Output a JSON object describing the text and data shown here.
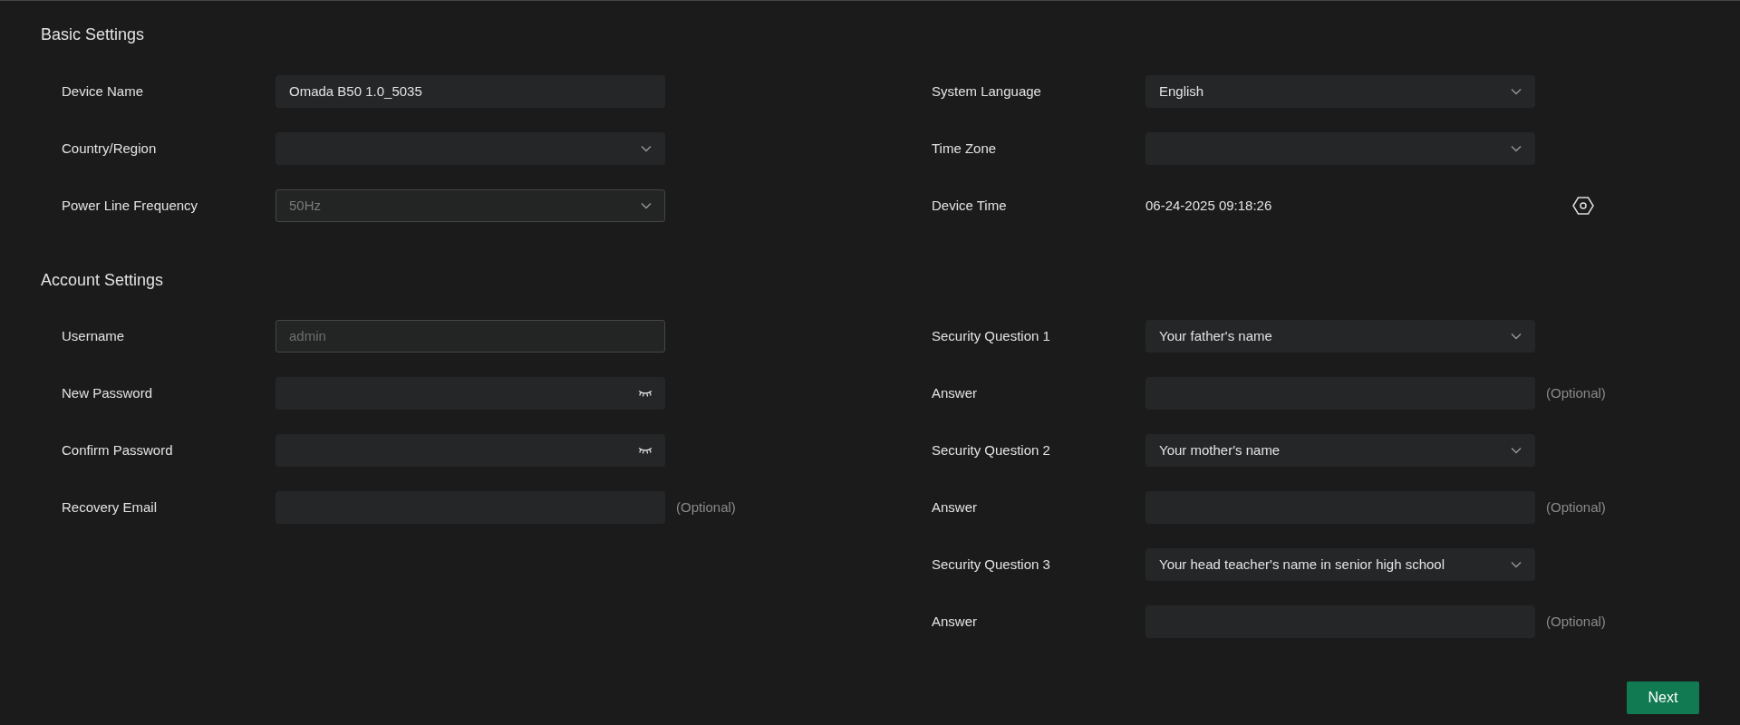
{
  "sections": [
    {
      "title": "Basic Settings",
      "left": [
        {
          "label": "Device Name",
          "kind": "text",
          "value": "Omada B50 1.0_5035",
          "disabled": false
        },
        {
          "label": "Country/Region",
          "kind": "select",
          "disabled": false
        },
        {
          "label": "Power Line Frequency",
          "kind": "select",
          "value": "50Hz",
          "disabled": true
        }
      ],
      "right": [
        {
          "label": "System Language",
          "kind": "select",
          "value": "English",
          "disabled": false
        },
        {
          "label": "Time Zone",
          "kind": "select",
          "disabled": false
        },
        {
          "label": "Device Time",
          "kind": "static",
          "value": "06-24-2025 09:18:26",
          "disabled": false
        }
      ]
    },
    {
      "title": "Account Settings",
      "left": [
        {
          "label": "Username",
          "kind": "text",
          "placeholder": "admin",
          "disabled": true
        },
        {
          "label": "New Password",
          "kind": "password",
          "disabled": false
        },
        {
          "label": "Confirm Password",
          "kind": "password",
          "disabled": false
        },
        {
          "label": "Recovery Email",
          "kind": "text",
          "note": "(Optional)",
          "disabled": false
        }
      ],
      "right": [
        {
          "label": "Security Question 1",
          "kind": "select",
          "value": "Your father's name",
          "disabled": false
        },
        {
          "label": "Answer",
          "kind": "text",
          "note": "(Optional)",
          "disabled": false
        },
        {
          "label": "Security Question 2",
          "kind": "select",
          "value": "Your mother's name",
          "disabled": false
        },
        {
          "label": "Answer",
          "kind": "text",
          "note": "(Optional)",
          "disabled": false
        },
        {
          "label": "Security Question 3",
          "kind": "select",
          "value": "Your head teacher's name in senior high school",
          "disabled": false
        },
        {
          "label": "Answer",
          "kind": "text",
          "note": "(Optional)",
          "disabled": false
        }
      ]
    }
  ],
  "next_button": "Next"
}
